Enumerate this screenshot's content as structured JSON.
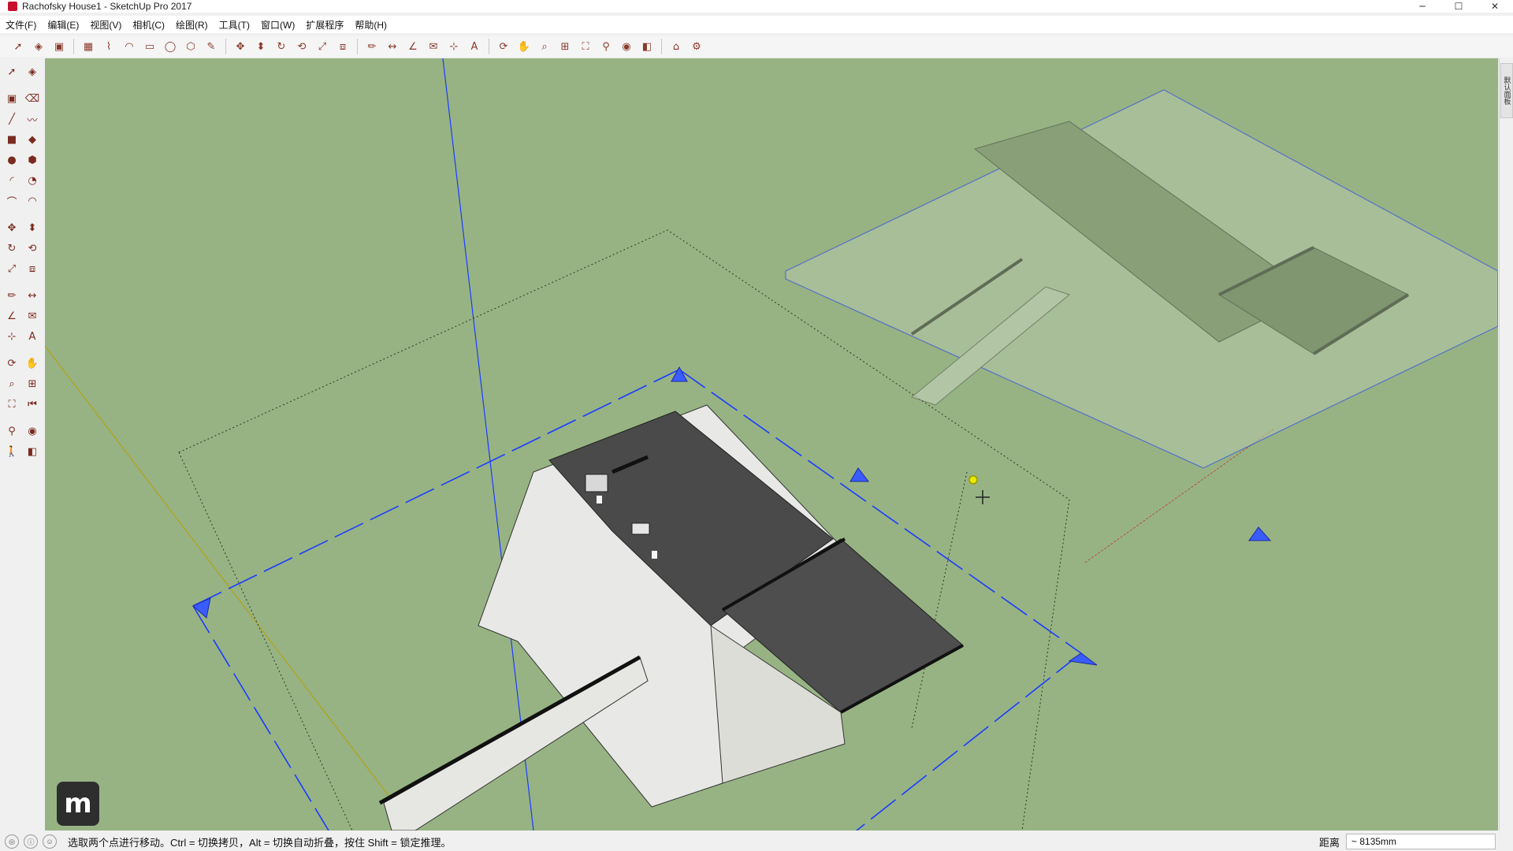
{
  "window": {
    "title": "Rachofsky House1 - SketchUp Pro 2017",
    "minimize": "─",
    "maximize": "☐",
    "close": "✕"
  },
  "menus": [
    "文件(F)",
    "编辑(E)",
    "视图(V)",
    "相机(C)",
    "绘图(R)",
    "工具(T)",
    "窗口(W)",
    "扩展程序",
    "帮助(H)"
  ],
  "toolbar_icons": [
    "select-icon",
    "component-icon",
    "paint-icon",
    "eraser-icon",
    "line-icon",
    "arc-icon",
    "rectangle-icon",
    "circle-icon",
    "polygon-icon",
    "freehand-icon",
    "move-icon",
    "push-pull-icon",
    "rotate-icon",
    "follow-me-icon",
    "scale-icon",
    "offset-icon",
    "tape-icon",
    "dimension-icon",
    "protractor-icon",
    "text-icon",
    "axes-icon",
    "3d-text-icon",
    "orbit-icon",
    "pan-icon",
    "zoom-icon",
    "zoom-window-icon",
    "zoom-extents-icon",
    "walk-icon",
    "look-around-icon",
    "section-plane-icon",
    "warehouse-icon",
    "extension-icon"
  ],
  "left_tools": [
    "select-icon",
    "component-icon",
    "paint-icon",
    "eraser-icon",
    "line-icon",
    "freehand-icon",
    "rectangle-icon",
    "rotated-rect-icon",
    "circle-icon",
    "polygon-icon",
    "arc-icon",
    "pie-icon",
    "2pt-arc-icon",
    "3pt-arc-icon",
    "move-icon",
    "push-pull-icon",
    "rotate-icon",
    "follow-me-icon",
    "scale-icon",
    "offset-icon",
    "tape-icon",
    "dimension-icon",
    "protractor-icon",
    "text-icon",
    "axes-icon",
    "3d-text-icon",
    "orbit-icon",
    "pan-icon",
    "zoom-icon",
    "zoom-window-icon",
    "zoom-extents-icon",
    "previous-view-icon",
    "position-camera-icon",
    "look-around-icon",
    "walk-icon",
    "section-plane-icon"
  ],
  "right_panel": {
    "tab_label": "默认面板"
  },
  "status": {
    "message": "选取两个点进行移动。Ctrl = 切换拷贝，Alt = 切换自动折叠，按住 Shift = 锁定推理。",
    "measure_label": "距离",
    "measure_value": "~ 8135mm"
  },
  "logo": {
    "letter": "m"
  },
  "colors": {
    "viewport_bg": "#97b383",
    "roof_dark": "#4a4a4a",
    "selection_blue": "#1a3cff",
    "axis_red": "#c0392b",
    "axis_green": "#2e7d32",
    "axis_yellow": "#b8a000"
  }
}
